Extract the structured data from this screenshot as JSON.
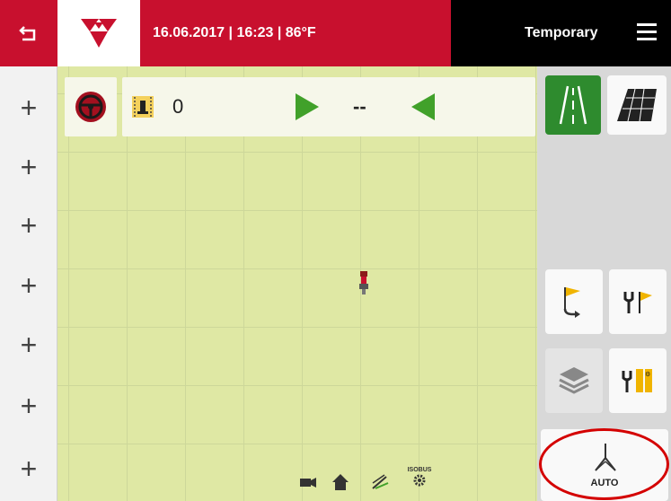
{
  "header": {
    "datetime": "16.06.2017 | 16:23 | 86°F",
    "mode": "Temporary"
  },
  "icons": {
    "back": "back-arrow-icon",
    "logo": "brand-triangles-logo",
    "menu": "hamburger-menu-icon"
  },
  "left_column": {
    "buttons": [
      "+",
      "+",
      "+",
      "+",
      "+",
      "+",
      "+"
    ]
  },
  "info_bar": {
    "count": "0",
    "distance": "--"
  },
  "bottom_bar": {
    "isobus_label": "ISOBUS"
  },
  "right_panel": {
    "auto_label": "AUTO"
  },
  "colors": {
    "brand_red": "#c8102e",
    "field_green": "#dfe8a4",
    "accent_green": "#41a12a",
    "selected_green": "#2e8b2e",
    "highlight_circle": "#d40000"
  }
}
